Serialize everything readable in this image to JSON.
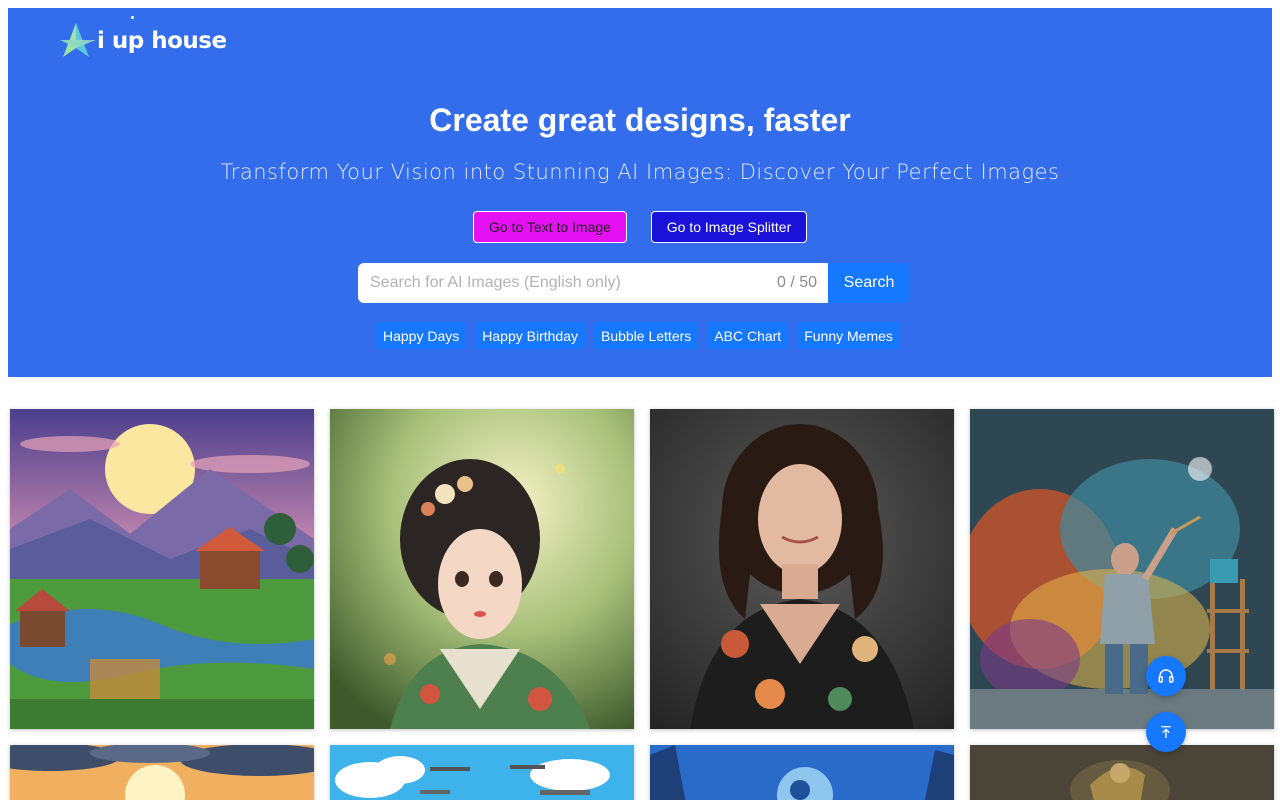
{
  "brand": {
    "logo_text": "i up house",
    "icon": "logo-icon"
  },
  "hero": {
    "title": "Create great designs, faster",
    "subtitle": "Transform Your Vision into Stunning AI Images: Discover Your Perfect Images",
    "buttons": {
      "text_to_image": "Go to Text to Image",
      "image_splitter": "Go to Image Splitter"
    },
    "search": {
      "placeholder": "Search for AI Images (English only)",
      "value": "",
      "counter": "0 / 50",
      "button_label": "Search"
    },
    "tags": [
      "Happy Days",
      "Happy Birthday",
      "Bubble Letters",
      "ABC Chart",
      "Funny Memes"
    ]
  },
  "gallery": {
    "images": [
      {
        "subject": "pixel-art farm village at sunset"
      },
      {
        "subject": "anime girl with flowers in hair"
      },
      {
        "subject": "portrait of smiling woman in floral dress"
      },
      {
        "subject": "child painting colorful wall"
      },
      {
        "subject": "sunset clouds"
      },
      {
        "subject": "airplanes in blue sky"
      },
      {
        "subject": "fantasy moon night"
      },
      {
        "subject": "golden statue"
      }
    ]
  },
  "floating": {
    "support_icon": "headphones-icon",
    "top_icon": "back-to-top-icon"
  },
  "colors": {
    "hero_bg": "#336deb",
    "primary": "#1677ff",
    "btn_text_to_image": "#e511f2",
    "btn_image_splitter": "#1a12d9"
  }
}
